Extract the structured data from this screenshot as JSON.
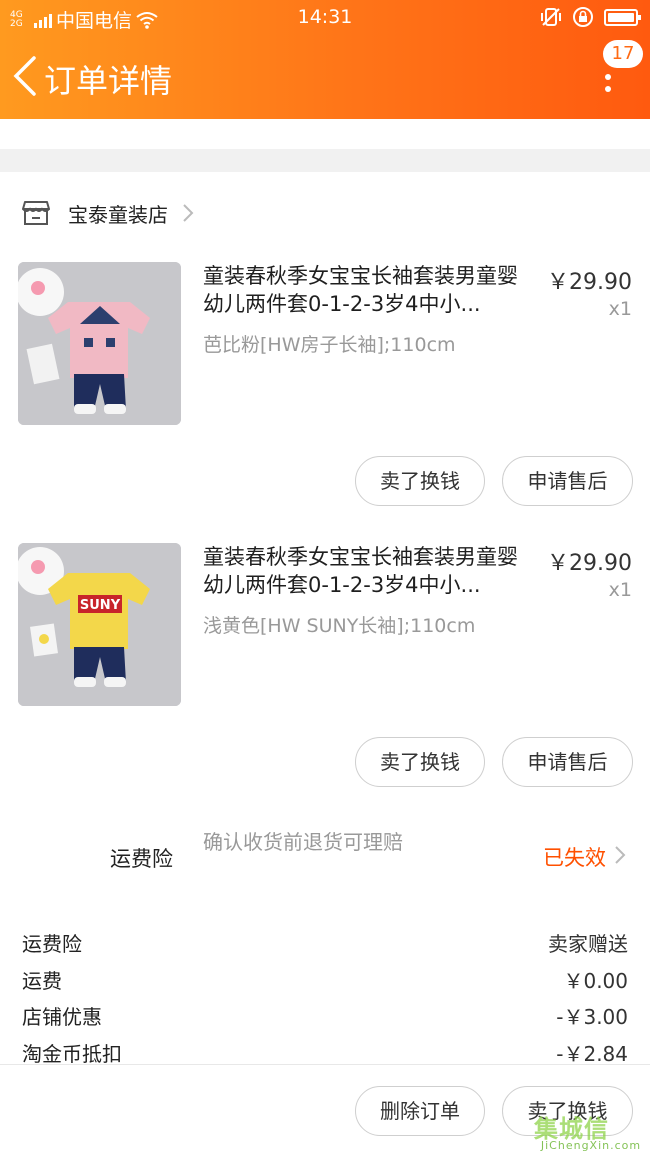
{
  "status_bar": {
    "network": "4G 2G",
    "carrier": "中国电信",
    "time": "14:31"
  },
  "nav": {
    "title": "订单详情",
    "message_count": "17"
  },
  "shop": {
    "name": "宝泰童装店"
  },
  "products": [
    {
      "title": "童装春秋季女宝宝长袖套装男童婴幼儿两件套0-1-2-3岁4中小...",
      "price": "￥29.90",
      "quantity": "x1",
      "sku": "芭比粉[HW房子长袖];110cm",
      "shirt_color": "#f1b9c4",
      "sell_label": "卖了换钱",
      "after_sale_label": "申请售后"
    },
    {
      "title": "童装春秋季女宝宝长袖套装男童婴幼儿两件套0-1-2-3岁4中小...",
      "price": "￥29.90",
      "quantity": "x1",
      "sku": "浅黄色[HW SUNY长袖];110cm",
      "shirt_color": "#f3d74a",
      "shirt_print": "SUNY",
      "sell_label": "卖了换钱",
      "after_sale_label": "申请售后"
    }
  ],
  "insurance": {
    "label": "运费险",
    "description": "确认收货前退货可理赔",
    "status": "已失效"
  },
  "fees": [
    {
      "label": "运费险",
      "value": "卖家赠送"
    },
    {
      "label": "运费",
      "value": "￥0.00"
    },
    {
      "label": "店铺优惠",
      "value": "-￥3.00"
    },
    {
      "label": "淘金币抵扣",
      "value": "-￥2.84"
    }
  ],
  "bottom_bar": {
    "delete_label": "删除订单",
    "sell_label": "卖了换钱"
  },
  "watermark": {
    "logo": "集城信",
    "url": "JiChengXin.com"
  },
  "colors": {
    "header_start": "#ff9a1f",
    "header_end": "#ff5a0f",
    "accent": "#ff5000"
  }
}
